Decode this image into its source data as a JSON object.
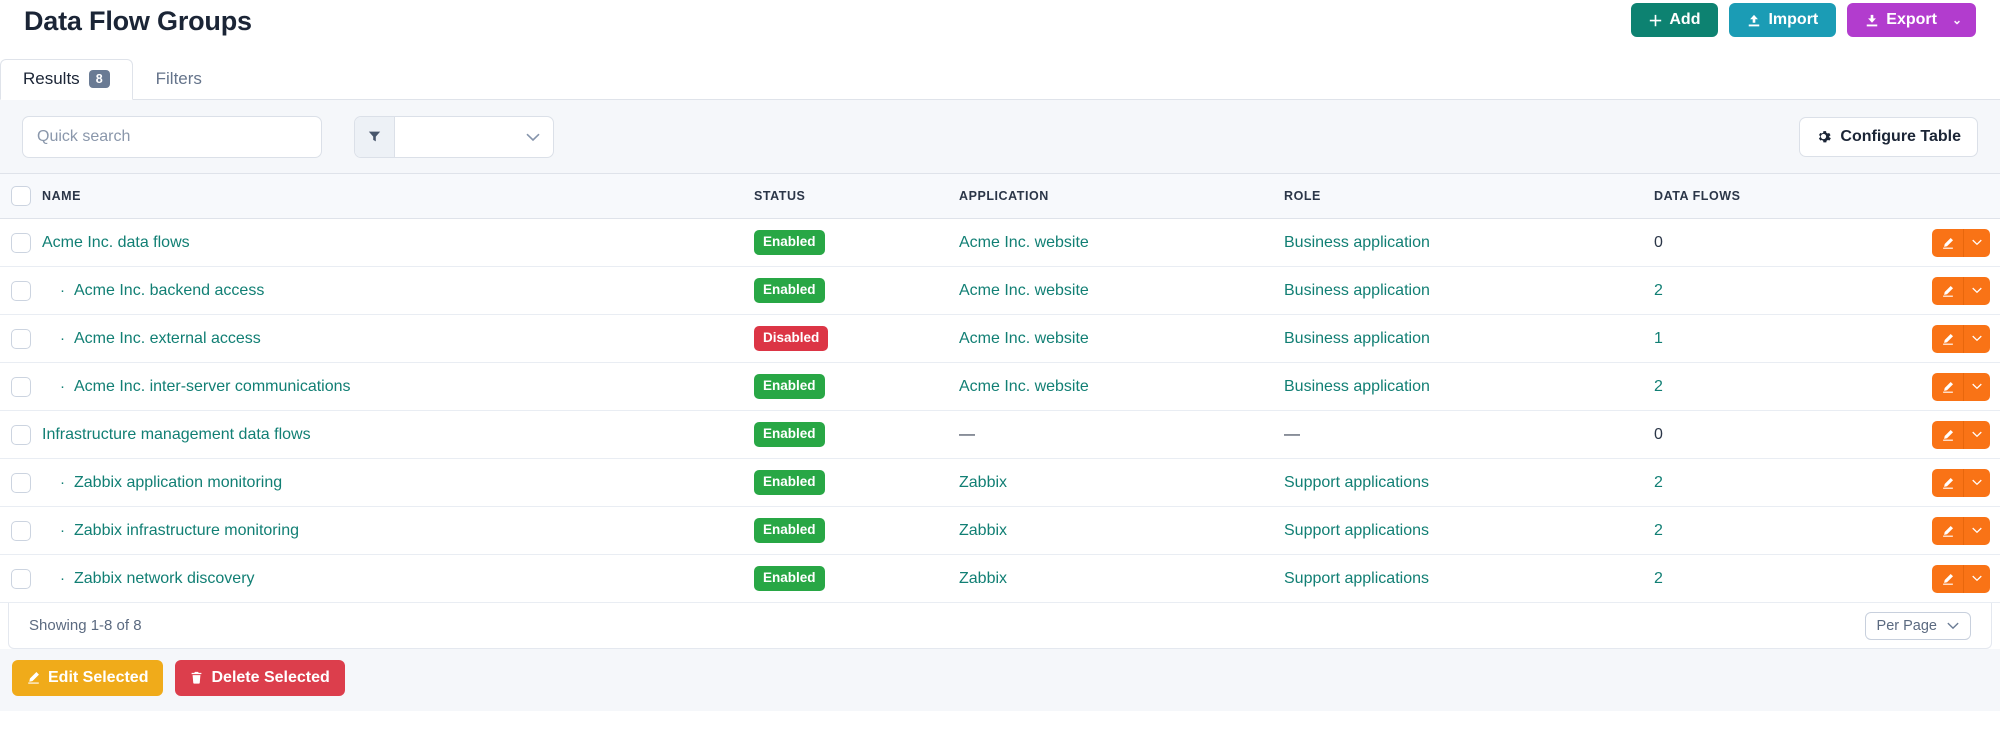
{
  "header": {
    "title": "Data Flow Groups",
    "actions": [
      {
        "label": "Add",
        "icon": "plus-icon",
        "color": "#0d8271"
      },
      {
        "label": "Import",
        "icon": "upload-icon",
        "color": "#1b9cb5"
      },
      {
        "label": "Export",
        "icon": "download-icon",
        "color": "#b23cce",
        "caret": "⌄"
      }
    ]
  },
  "tabs": [
    {
      "label": "Results",
      "badge": "8",
      "active": true
    },
    {
      "label": "Filters",
      "badge": "",
      "active": false
    }
  ],
  "toolbar": {
    "search_placeholder": "Quick search",
    "search_value": "",
    "filter_icon": "funnel-icon",
    "filter_value": "",
    "filter_caret": "⌄",
    "configure_label": "Configure Table",
    "configure_icon": "gear-icon"
  },
  "table": {
    "columns": [
      "NAME",
      "STATUS",
      "APPLICATION",
      "ROLE",
      "DATA FLOWS"
    ],
    "rows": [
      {
        "name": "Acme Inc. data flows",
        "child": false,
        "status": "Enabled",
        "status_kind": "enabled",
        "application": "Acme Inc. website",
        "app_link": true,
        "role": "Business application",
        "role_link": true,
        "flows": "0",
        "flows_link": false
      },
      {
        "name": "Acme Inc. backend access",
        "child": true,
        "status": "Enabled",
        "status_kind": "enabled",
        "application": "Acme Inc. website",
        "app_link": true,
        "role": "Business application",
        "role_link": true,
        "flows": "2",
        "flows_link": true
      },
      {
        "name": "Acme Inc. external access",
        "child": true,
        "status": "Disabled",
        "status_kind": "disabled",
        "application": "Acme Inc. website",
        "app_link": true,
        "role": "Business application",
        "role_link": true,
        "flows": "1",
        "flows_link": true
      },
      {
        "name": "Acme Inc. inter-server communications",
        "child": true,
        "status": "Enabled",
        "status_kind": "enabled",
        "application": "Acme Inc. website",
        "app_link": true,
        "role": "Business application",
        "role_link": true,
        "flows": "2",
        "flows_link": true
      },
      {
        "name": "Infrastructure management data flows",
        "child": false,
        "status": "Enabled",
        "status_kind": "enabled",
        "application": "—",
        "app_link": false,
        "role": "—",
        "role_link": false,
        "flows": "0",
        "flows_link": false
      },
      {
        "name": "Zabbix application monitoring",
        "child": true,
        "status": "Enabled",
        "status_kind": "enabled",
        "application": "Zabbix",
        "app_link": true,
        "role": "Support applications",
        "role_link": true,
        "flows": "2",
        "flows_link": true
      },
      {
        "name": "Zabbix infrastructure monitoring",
        "child": true,
        "status": "Enabled",
        "status_kind": "enabled",
        "application": "Zabbix",
        "app_link": true,
        "role": "Support applications",
        "role_link": true,
        "flows": "2",
        "flows_link": true
      },
      {
        "name": "Zabbix network discovery",
        "child": true,
        "status": "Enabled",
        "status_kind": "enabled",
        "application": "Zabbix",
        "app_link": true,
        "role": "Support applications",
        "role_link": true,
        "flows": "2",
        "flows_link": true
      }
    ],
    "row_action": {
      "edit_icon": "pencil-icon",
      "caret": "⌄"
    }
  },
  "footer": {
    "showing": "Showing 1-8 of 8",
    "per_page_label": "Per Page",
    "per_page_caret": "⌄"
  },
  "bulk": [
    {
      "label": "Edit Selected",
      "icon": "pencil-icon",
      "color": "#f0ab1a"
    },
    {
      "label": "Delete Selected",
      "icon": "trash-icon",
      "color": "#dc3e4c"
    }
  ],
  "colors": {
    "link": "#117f74",
    "enabled": "#28a745",
    "disabled": "#dc3545",
    "action_orange": "#f97316",
    "page_bg": "#f5f7fa"
  }
}
